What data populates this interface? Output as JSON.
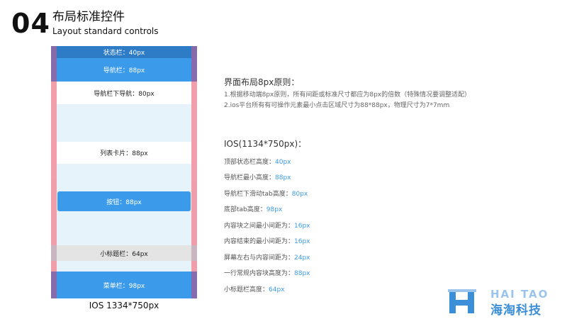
{
  "header": {
    "number": "04",
    "title_cn": "布局标准控件",
    "title_en": "Layout standard controls"
  },
  "phone": {
    "statusbar": "状态栏：40px",
    "navbar": "导航栏：88px",
    "subnav": "导航栏下导航：80px",
    "listcard": "列表卡片：88px",
    "button": "按钮：88px",
    "subtitle_bar": "小标题栏：64px",
    "menubar": "菜单栏：98px",
    "caption": "IOS  1334*750px"
  },
  "principle": {
    "title": "界面布局8px原则：",
    "lines": [
      "1.根据移动端8px原则，所有间距或标准尺寸都应为8px的倍数（特殊情况要调整适配）",
      "2.ios平台所有有可操作元素最小点击区域尺寸为88*88px，物理尺寸为7*7mm"
    ]
  },
  "ios": {
    "title": "IOS(1134*750px)：",
    "specs": [
      {
        "label": "顶部状态栏高度：",
        "value": "40px"
      },
      {
        "label": "导航栏最小高度：",
        "value": "88px"
      },
      {
        "label": "导航栏下滑动tab高度：",
        "value": "80px"
      },
      {
        "label": "底部tab高度：",
        "value": "98px"
      },
      {
        "label": "内容块之间最小间距为：",
        "value": "16px"
      },
      {
        "label": "内容结束的最小间距为：",
        "value": "16px"
      },
      {
        "label": "屏幕左右与内容间距为：",
        "value": "24px"
      },
      {
        "label": "一行常规内容块高度为：",
        "value": "88px"
      },
      {
        "label": "小标题栏高度：",
        "value": "64px"
      }
    ]
  },
  "logo": {
    "text_en": "HAI TAO",
    "text_cn": "海淘科技",
    "icon": "h-logo-icon"
  },
  "colors": {
    "accent_blue": "#3b9bea",
    "status_blue": "#2e7cc6",
    "margin_pink": "#f19aa6",
    "margin_purple": "#8b6aa9",
    "content_bg": "#e6f3fb"
  }
}
